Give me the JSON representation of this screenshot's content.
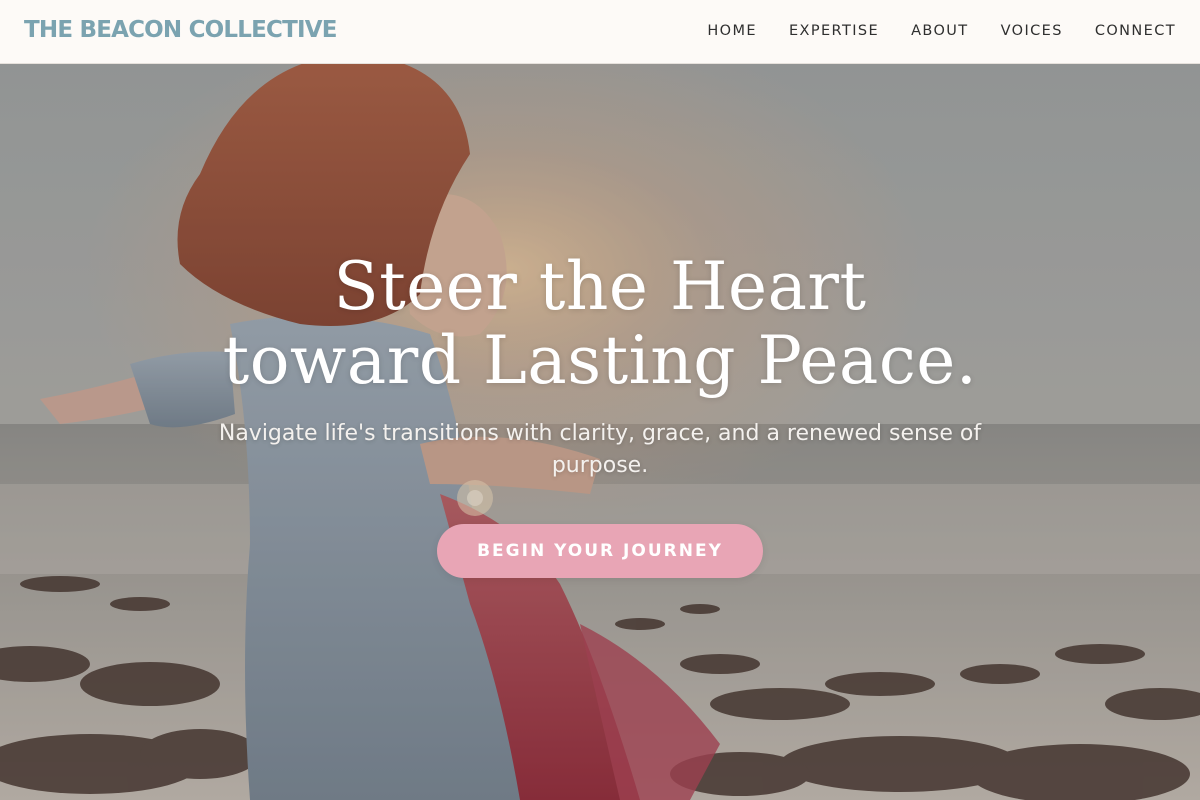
{
  "header": {
    "logo": "THE BEACON COLLECTIVE",
    "nav": [
      {
        "label": "HOME"
      },
      {
        "label": "EXPERTISE"
      },
      {
        "label": "ABOUT"
      },
      {
        "label": "VOICES"
      },
      {
        "label": "CONNECT"
      }
    ]
  },
  "hero": {
    "headline_line1": "Steer the Heart",
    "headline_line2": "toward Lasting Peace.",
    "subline": "Navigate life's transitions with clarity, grace, and a renewed sense of purpose.",
    "cta_label": "BEGIN YOUR JOURNEY",
    "background_image": "woman-with-outstretched-arms-at-rocky-seashore-photo"
  },
  "colors": {
    "logo": "#7ba3b0",
    "nav_text": "#2f2f2f",
    "header_bg": "#fdfaf7",
    "cta_bg": "#e8a5b5",
    "hero_text": "#ffffff"
  }
}
